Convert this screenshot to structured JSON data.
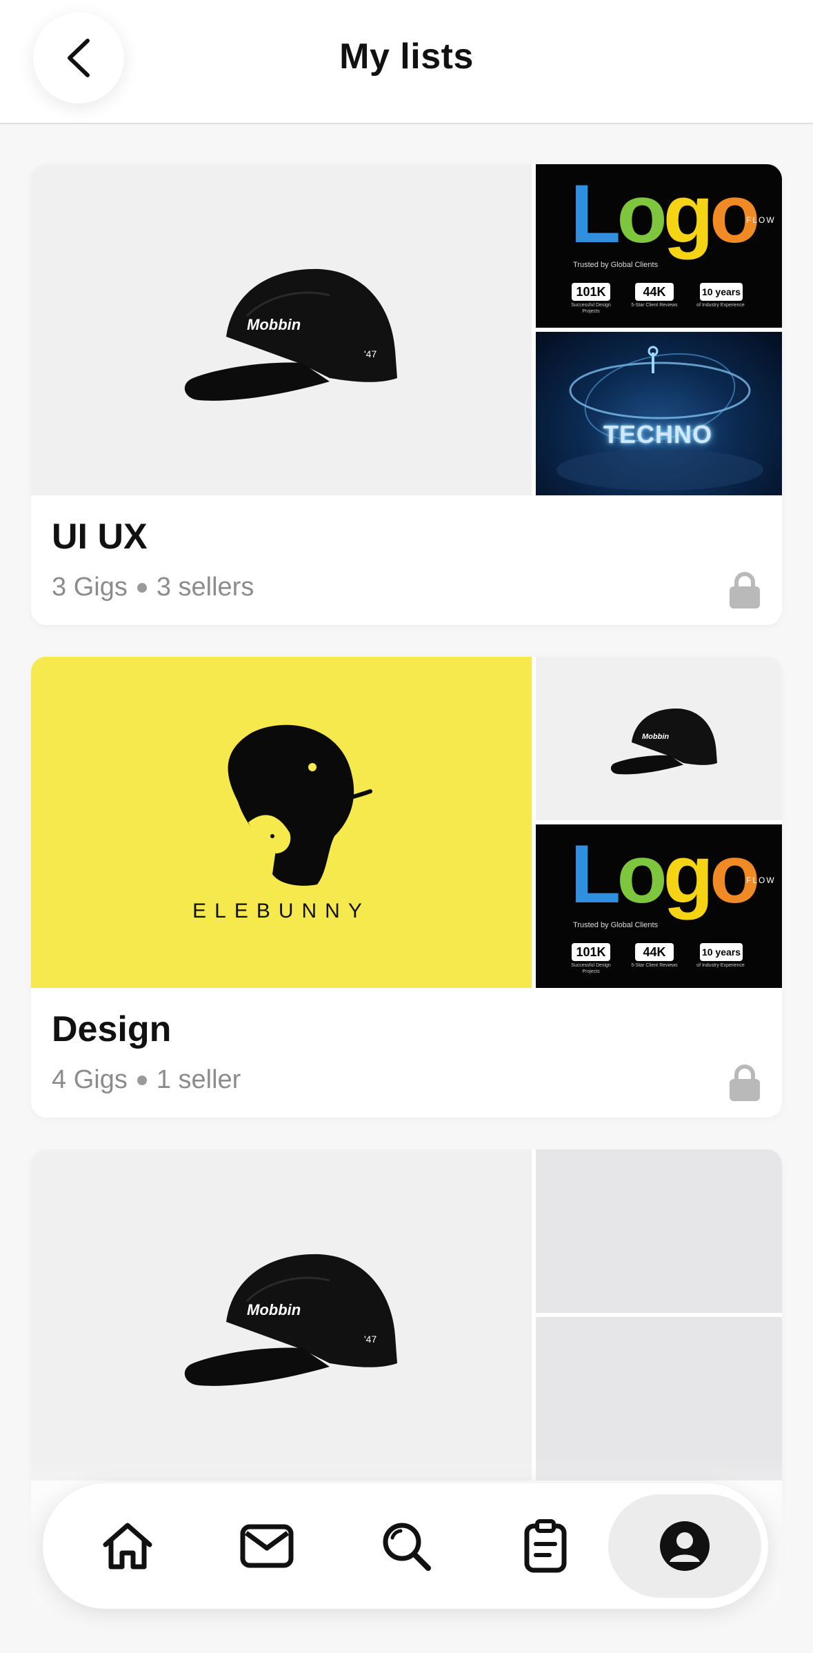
{
  "header": {
    "title": "My lists",
    "back_icon": "chevron-left-icon"
  },
  "lists": [
    {
      "title": "UI UX",
      "gigs": "3 Gigs",
      "sellers": "3 sellers",
      "images": [
        "cap-product",
        "logo-flow-banner",
        "techno-banner"
      ]
    },
    {
      "title": "Design",
      "gigs": "4 Gigs",
      "sellers": "1 seller",
      "images": [
        "elebunny-logo",
        "cap-product",
        "logo-flow-banner"
      ]
    },
    {
      "title": "",
      "images": [
        "cap-product",
        "empty",
        "empty"
      ]
    }
  ],
  "thumbs": {
    "cap_brand": "Mobbin",
    "cap_tag": "'47",
    "logoflow": {
      "logo": "Logo",
      "flow": "FLOW",
      "trusted": "Trusted by Global Clients",
      "stats": [
        {
          "value": "101K",
          "caption": "Successful Design Projects"
        },
        {
          "value": "44K",
          "caption": "5-Star Client Reviews"
        },
        {
          "value": "10 years",
          "caption": "of Industry Experience"
        }
      ]
    },
    "techno": "TECHNO",
    "elebunny": "ELEBUNNY"
  },
  "bottom_nav": [
    {
      "icon": "home-icon",
      "active": false
    },
    {
      "icon": "mail-icon",
      "active": false
    },
    {
      "icon": "search-icon",
      "active": false
    },
    {
      "icon": "clipboard-icon",
      "active": false
    },
    {
      "icon": "profile-icon",
      "active": true
    }
  ],
  "colors": {
    "logo_blue": "#2f8fe0",
    "logo_green": "#7ec63d",
    "logo_yellow": "#f5d416",
    "logo_orange": "#f08a24",
    "elebunny_yellow": "#f5e94d",
    "meta_grey": "#8c8c8c"
  }
}
